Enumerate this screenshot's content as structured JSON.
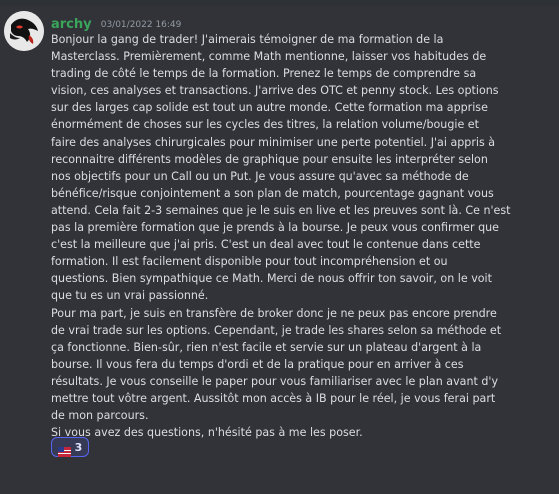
{
  "message": {
    "author": "archy",
    "timestamp": "03/01/2022 16:49",
    "author_color": "#3ba55c",
    "paragraphs": [
      "Bonjour la gang de trader! J'aimerais témoigner de ma formation de la\nMasterclass. Premièrement, comme Math mentionne, laisser vos habitudes de\ntrading de côté le temps de la formation. Prenez le temps de comprendre sa\nvision, ces analyses et transactions. J'arrive des OTC et penny stock. Les options\nsur des larges cap solide est tout un autre monde. Cette formation ma apprise\nénormément de choses sur les cycles des titres, la relation volume/bougie et\nfaire des analyses chirurgicales pour minimiser une perte potentiel. J'ai appris à\nreconnaitre différents modèles de graphique pour ensuite les interpréter selon\nnos objectifs pour un Call ou un Put. Je vous assure qu'avec sa méthode de\nbénéfice/risque conjointement a son plan de match, pourcentage gagnant vous\nattend. Cela fait 2-3 semaines que je le suis en live et les preuves sont là. Ce n'est\npas la première formation que je prends à la bourse. Je peux vous confirmer que\nc'est la meilleure que j'ai pris. C'est un deal avec tout le contenue dans cette\nformation. Il est facilement disponible pour tout incompréhension et ou\nquestions. Bien sympathique ce Math. Merci de nous offrir ton savoir, on le voit\nque tu es un vrai passionné.",
      "Pour ma part, je suis en transfère de broker donc je ne peux pas encore prendre\nde vrai trade sur les options. Cependant, je trade les shares selon sa méthode et\nça fonctionne. Bien-sûr, rien n'est facile et servie sur un plateau d'argent à la\nbourse. Il vous fera du temps d'ordi et de la pratique pour en arriver à ces\nrésultats. Je vous conseille le paper pour vous familiariser avec le plan avant d'y\nmettre tout vôtre argent. Aussitôt mon accès à IB pour le réel, je vous ferai part\nde mon parcours.",
      "Si vous avez des questions, n'hésité pas à me les poser."
    ]
  },
  "reaction": {
    "emoji": "flag-icon",
    "count": "3",
    "border_color": "#5865f2",
    "bg_color": "#373a54"
  },
  "colors": {
    "background": "#313338",
    "text": "#dbdee1",
    "timestamp": "#949ba4"
  }
}
